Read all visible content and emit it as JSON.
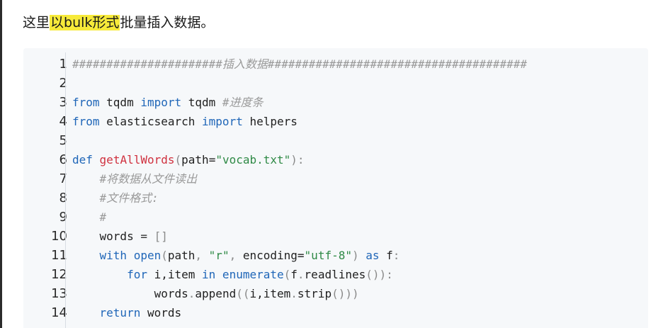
{
  "intro": {
    "before": "这里",
    "highlight": "以bulk形式",
    "after": "批量插入数据。"
  },
  "code": {
    "line_numbers": [
      "1",
      "2",
      "3",
      "4",
      "5",
      "6",
      "7",
      "8",
      "9",
      "10",
      "11",
      "12",
      "13",
      "14"
    ],
    "lines": {
      "l1": {
        "comment": "######################插入数据######################################"
      },
      "l3": {
        "kw1": "from",
        "mod": " tqdm ",
        "kw2": "import",
        "name": " tqdm ",
        "comment": "#进度条"
      },
      "l4": {
        "kw1": "from",
        "mod": " elasticsearch ",
        "kw2": "import",
        "name": " helpers"
      },
      "l6": {
        "kw": "def",
        "fn": "getAllWords",
        "p1": "(",
        "arg": "path=",
        "str": "\"vocab.txt\"",
        "p2": "):"
      },
      "l7": {
        "comment": "#将数据从文件读出"
      },
      "l8": {
        "comment": "#文件格式:"
      },
      "l9": {
        "comment": "#"
      },
      "l10": {
        "var": "words",
        "op": " = ",
        "val": "[]"
      },
      "l11": {
        "kw": "with",
        "fn": "open",
        "p1": "(",
        "a1": "path",
        "c1": ", ",
        "s1": "\"r\"",
        "c2": ", ",
        "a2": "encoding=",
        "s2": "\"utf-8\"",
        "p2": ") ",
        "kw2": "as",
        "a3": " f",
        "p3": ":"
      },
      "l12": {
        "kw": "for",
        "a1": " i,item ",
        "kw2": "in",
        "fn": " enumerate",
        "p1": "(",
        "a2": "f",
        "p2": ".",
        "a3": "readlines",
        "p3": "()):"
      },
      "l13": {
        "a1": "words",
        "p1": ".",
        "a2": "append",
        "p2": "((",
        "a3": "i,item",
        "p3": ".",
        "a4": "strip",
        "p4": "()))"
      },
      "l14": {
        "kw": "return",
        "a1": " words"
      }
    }
  }
}
